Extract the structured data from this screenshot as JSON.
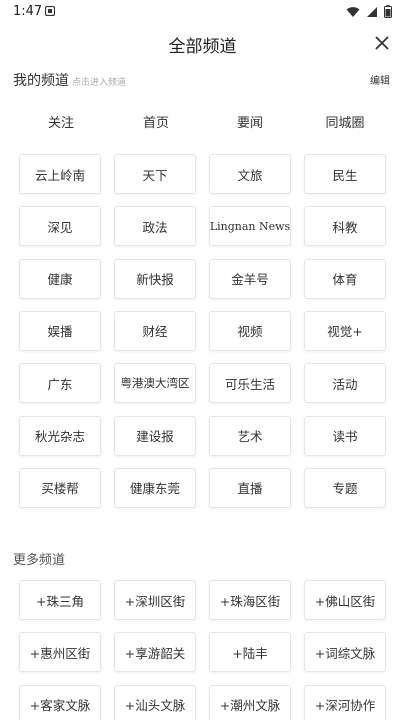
{
  "status": {
    "time": "1:47"
  },
  "header": {
    "title": "全部频道"
  },
  "my_channels": {
    "title": "我的频道",
    "hint": "点击进入频道",
    "edit_label": "编辑",
    "fixed": [
      "关注",
      "首页",
      "要闻",
      "同城圈"
    ],
    "items": [
      "云上岭南",
      "天下",
      "文旅",
      "民生",
      "深见",
      "政法",
      "Lingnan News",
      "科教",
      "健康",
      "新快报",
      "金羊号",
      "体育",
      "娱播",
      "财经",
      "视频",
      "视觉+",
      "广东",
      "粤港澳大湾区",
      "可乐生活",
      "活动",
      "秋光杂志",
      "建设报",
      "艺术",
      "读书",
      "买楼帮",
      "健康东莞",
      "直播",
      "专题"
    ]
  },
  "more_channels": {
    "title": "更多频道",
    "items": [
      "+珠三角",
      "+深圳区街",
      "+珠海区街",
      "+佛山区街",
      "+惠州区街",
      "+享游韶关",
      "+陆丰",
      "+词综文脉",
      "+客家文脉",
      "+汕头文脉",
      "+潮州文脉",
      "+深河协作"
    ]
  }
}
